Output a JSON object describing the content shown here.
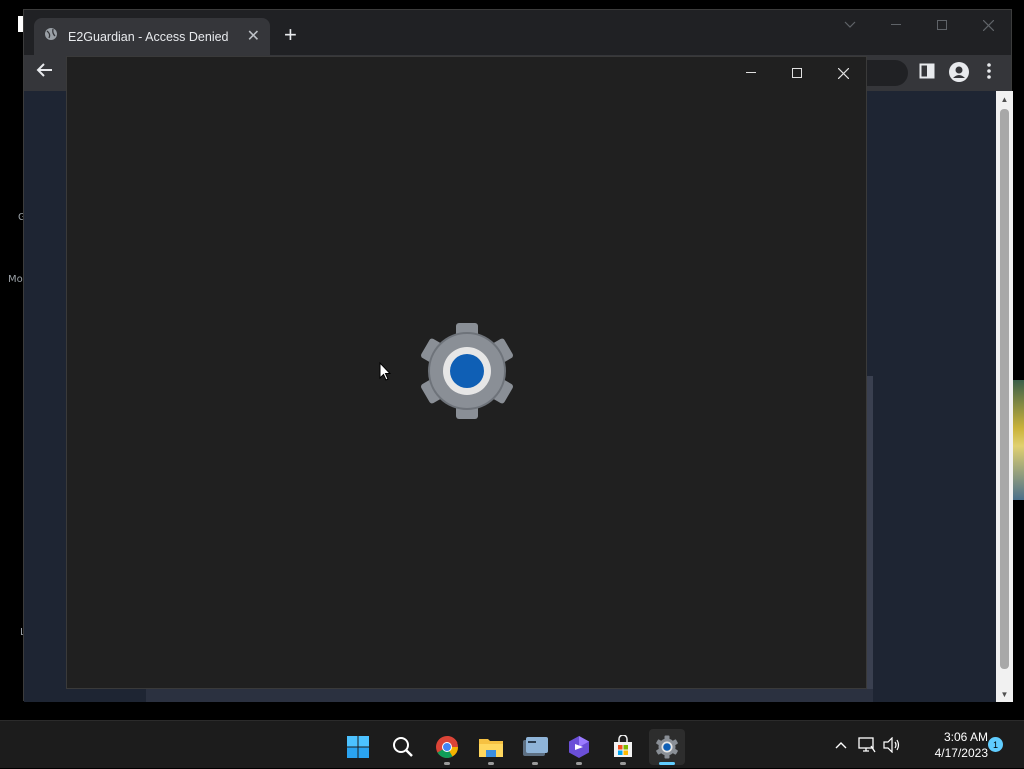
{
  "desktop": {
    "labels": [
      {
        "text": "G"
      },
      {
        "text": "Mo"
      },
      {
        "text": "L"
      }
    ]
  },
  "browser": {
    "tab": {
      "title": "E2Guardian - Access Denied",
      "close": "✕"
    },
    "new_tab": "+",
    "scroll_up": "▲",
    "scroll_down": "▼"
  },
  "settings_window": {
    "icon": "settings-gear-icon"
  },
  "taskbar": {
    "items": [
      "windows-start-icon",
      "search-icon",
      "chrome-icon",
      "file-explorer-icon",
      "terminal-icon",
      "app-icon",
      "microsoft-store-icon",
      "settings-icon"
    ],
    "clock": {
      "time": "3:06 AM",
      "date": "4/17/2023"
    },
    "notification_count": "1"
  },
  "colors": {
    "accent": "#60cdff",
    "gear_center": "#0f5fb5",
    "gear_body": "#8a8f96"
  }
}
